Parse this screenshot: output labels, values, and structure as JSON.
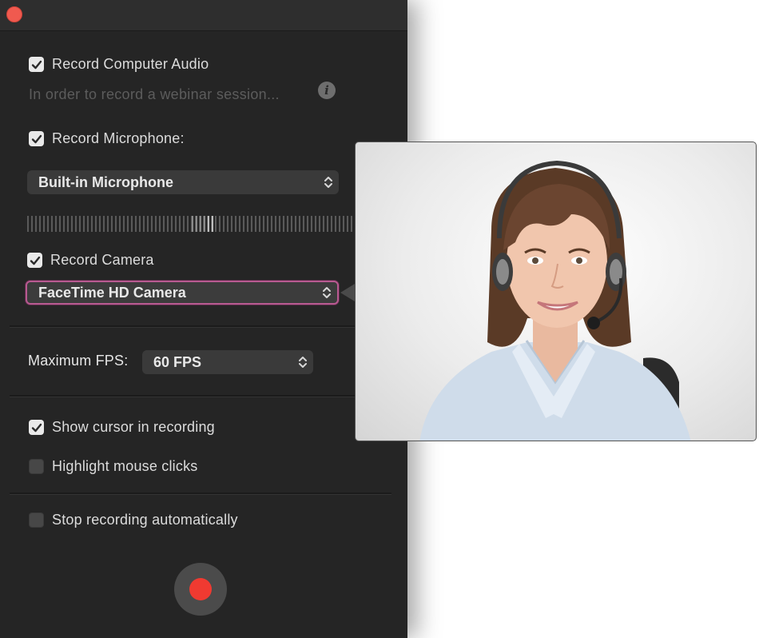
{
  "settings": {
    "record_computer_audio": {
      "label": "Record Computer Audio",
      "checked": true
    },
    "audio_hint": "In order to record a webinar session...",
    "record_microphone": {
      "label": "Record Microphone:",
      "checked": true
    },
    "microphone_select": "Built-in Microphone",
    "record_camera": {
      "label": "Record Camera",
      "checked": true
    },
    "camera_select": "FaceTime HD Camera",
    "max_fps_label": "Maximum FPS:",
    "fps_select": "60 FPS",
    "show_cursor": {
      "label": "Show cursor in recording",
      "checked": true
    },
    "highlight_clicks": {
      "label": "Highlight mouse clicks",
      "checked": false
    },
    "stop_auto": {
      "label": "Stop recording automatically",
      "checked": false
    }
  },
  "icons": {
    "close": "close-icon",
    "info": "info-icon",
    "record": "record-icon",
    "checkmark": "checkmark-icon",
    "chevron": "chevron-updown-icon"
  },
  "colors": {
    "accent_focus": "#b85a91",
    "record_red": "#f03a31",
    "close_red": "#f05a4f",
    "panel_bg": "#252525"
  }
}
